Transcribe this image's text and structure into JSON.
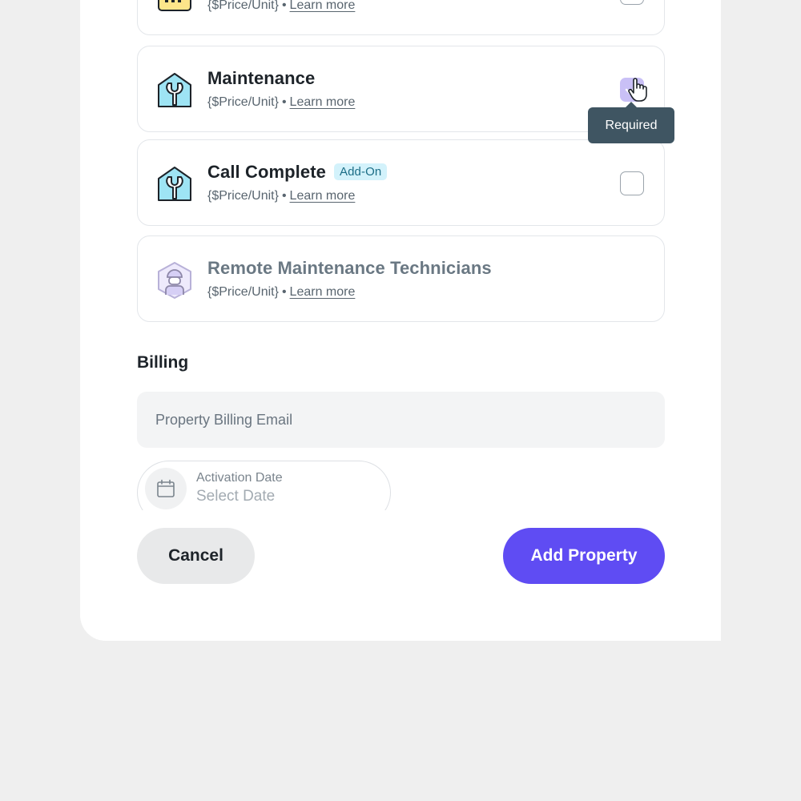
{
  "products": [
    {
      "title": "",
      "price": "{$Price/Unit}",
      "separator": "•",
      "link": "Learn more",
      "icon": "rate-card-icon"
    },
    {
      "title": "Maintenance",
      "price": "{$Price/Unit}",
      "separator": "•",
      "link": "Learn more",
      "icon": "wrench-house-icon",
      "checked": true,
      "tooltip": "Required"
    },
    {
      "title": "Call Complete",
      "badge": "Add-On",
      "price": "{$Price/Unit}",
      "separator": "•",
      "link": "Learn more",
      "icon": "wrench-house-icon",
      "checked": false
    },
    {
      "title": "Remote Maintenance Technicians",
      "price": "{$Price/Unit}",
      "separator": "•",
      "link": "Learn more",
      "icon": "technician-icon",
      "disabled": true
    }
  ],
  "billing": {
    "heading": "Billing",
    "email_placeholder": "Property Billing Email",
    "activation_label": "Activation Date",
    "activation_value": "Select Date"
  },
  "actions": {
    "cancel_label": "Cancel",
    "submit_label": "Add Property"
  },
  "colors": {
    "primary": "#5f4cf3",
    "checkbox_checked": "#c9c0f6",
    "tooltip_bg": "#3f5562",
    "badge_bg": "#d3f2fb"
  }
}
